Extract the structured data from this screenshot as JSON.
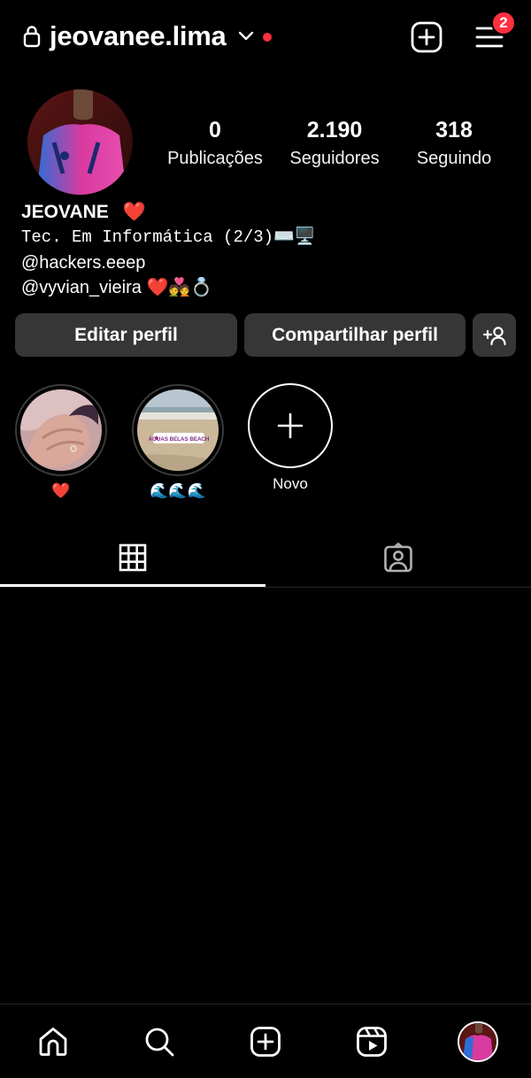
{
  "header": {
    "username": "jeovanee.lima",
    "notification_count": "2",
    "icons": [
      "lock-icon",
      "chevron-down-icon",
      "new-post-icon",
      "menu-icon"
    ]
  },
  "profile": {
    "stats": [
      {
        "value": "0",
        "label": "Publicações"
      },
      {
        "value": "2.190",
        "label": "Seguidores"
      },
      {
        "value": "318",
        "label": "Seguindo"
      }
    ],
    "display_name": "JEOVANE",
    "display_name_emoji": "❤️",
    "bio_line_1": "Tec. Em Informática (2/3)⌨️🖥️",
    "bio_line_2": "@hackers.eeep",
    "bio_line_3": "@vyvian_vieira ❤️💑💍"
  },
  "actions": {
    "edit_label": "Editar perfil",
    "share_label": "Compartilhar perfil",
    "discover_icon": "add-person-icon"
  },
  "highlights": [
    {
      "label": "❤️"
    },
    {
      "label": "🌊🌊🌊",
      "sticker_text": "ÁGUAS BELAS BEACH"
    },
    {
      "label": "Novo"
    }
  ],
  "tabs": [
    {
      "icon": "grid-icon",
      "active": true
    },
    {
      "icon": "tagged-icon",
      "active": false
    }
  ],
  "bottom_nav": [
    "home-icon",
    "search-icon",
    "create-icon",
    "reels-icon",
    "profile-avatar"
  ],
  "colors": {
    "background": "#000000",
    "button": "#363636",
    "badge": "#ff3040",
    "divider": "#262626"
  }
}
